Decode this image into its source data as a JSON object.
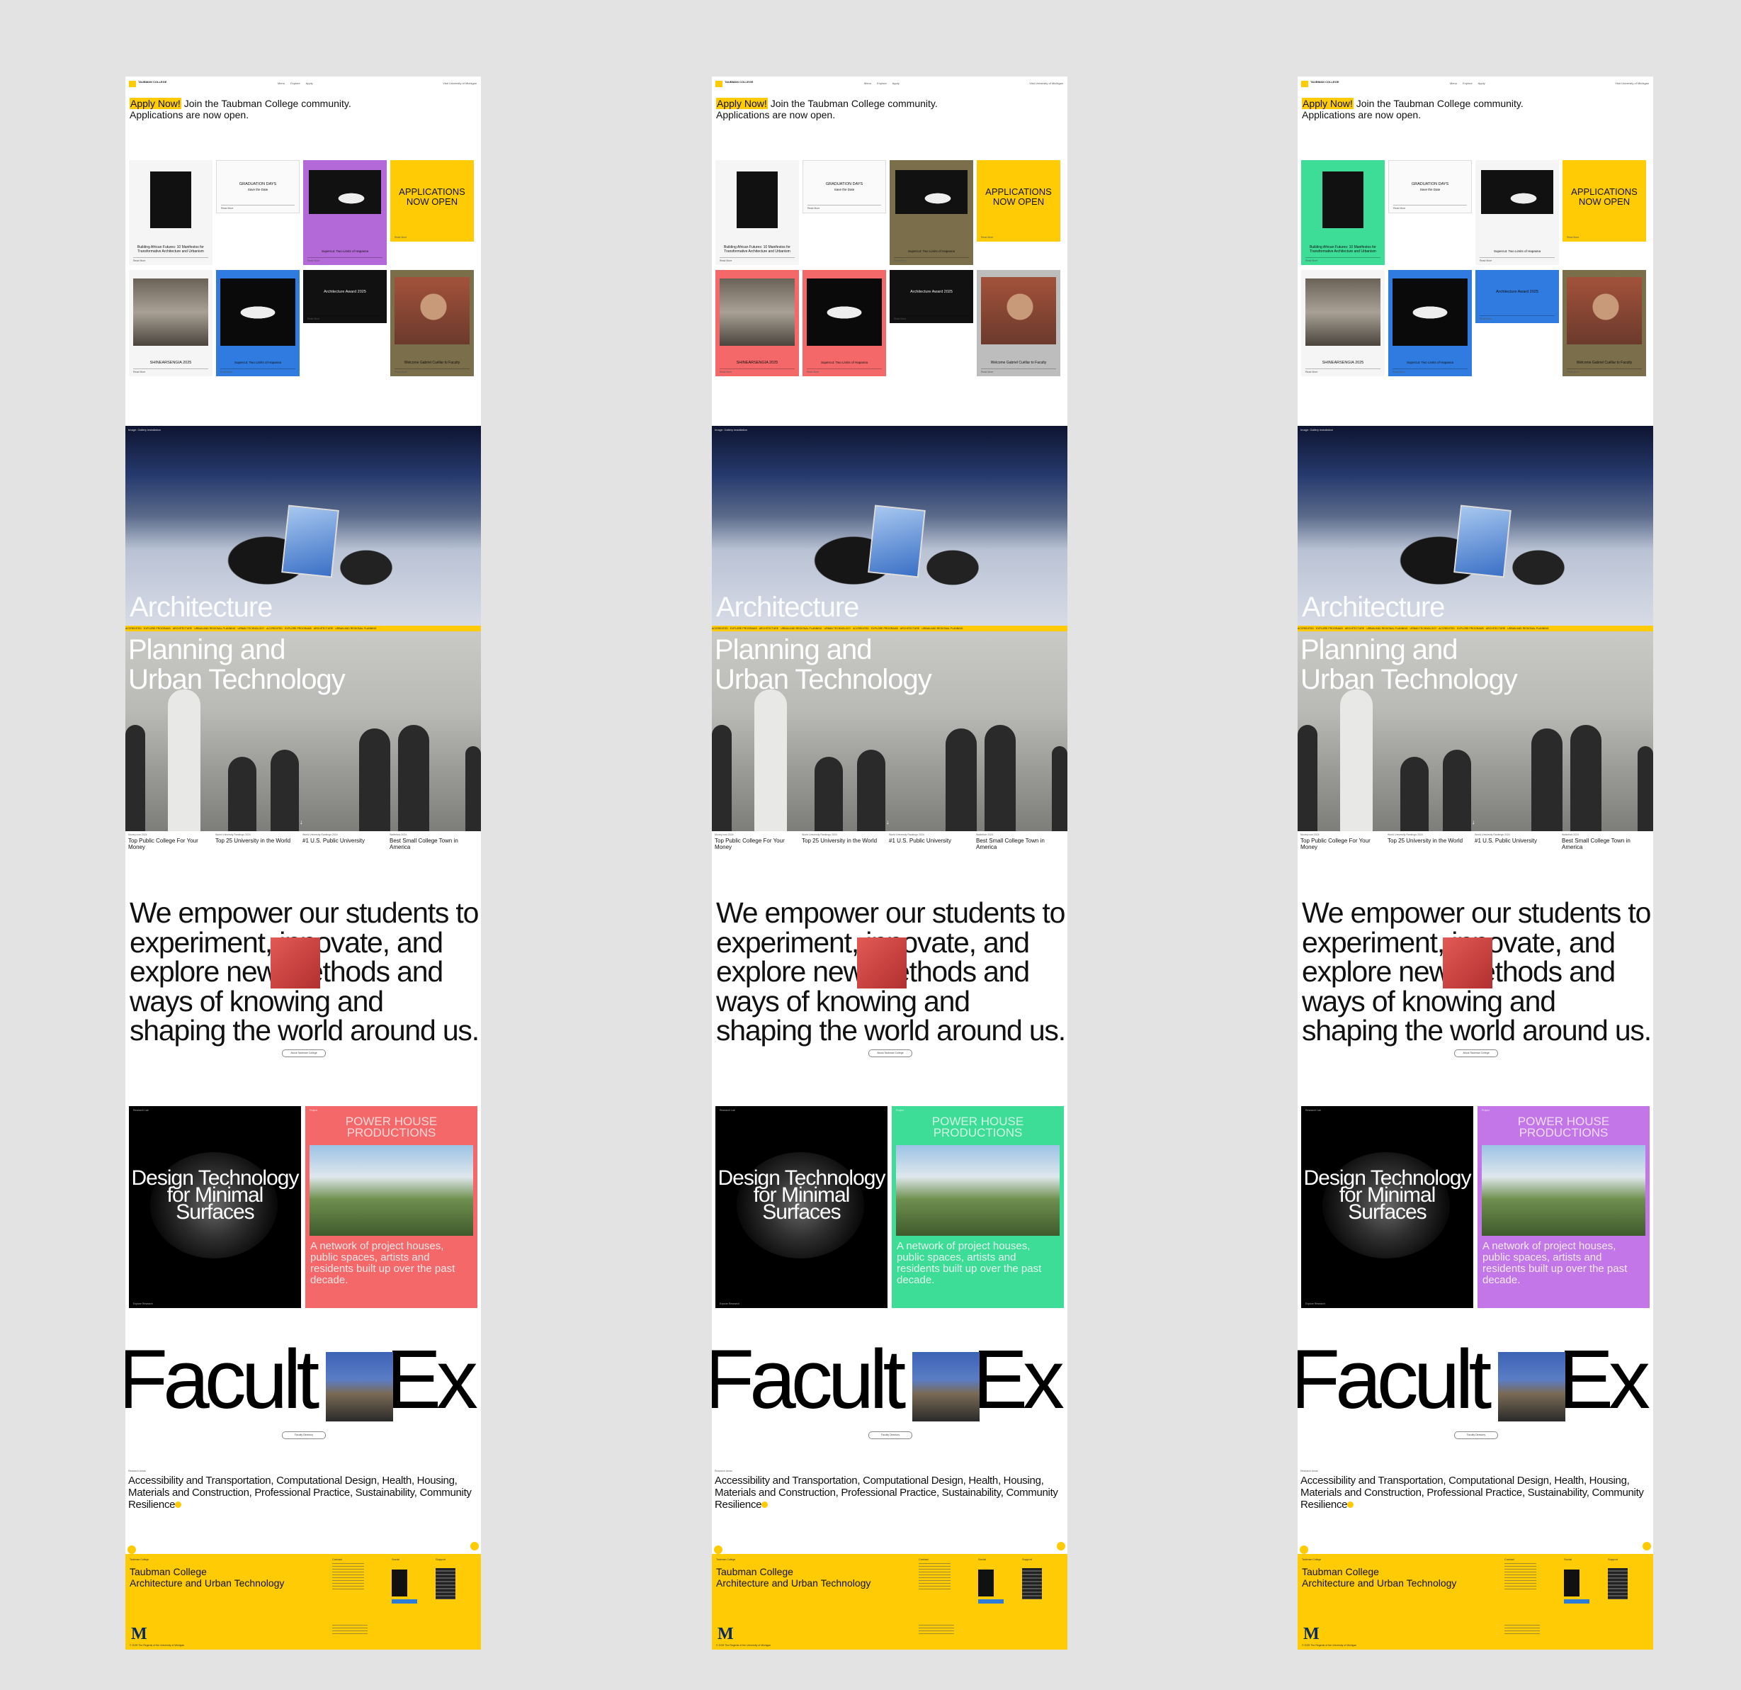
{
  "header": {
    "brand": "TAUBMAN COLLEGE",
    "nav": [
      "Menu",
      "Explore",
      "Apply"
    ],
    "um_link": "Visit University of Michigan"
  },
  "apply_banner": {
    "highlight": "Apply Now!",
    "text_line1": "Join the Taubman College community.",
    "text_line2": "Applications are now open."
  },
  "cards": {
    "building_title": "Building African Futures: 10 Manifestos for Transformative Architecture and Urbanism",
    "graduation_title": "GRADUATION DAYS",
    "graduation_sub": "Save the Date",
    "applications": "APPLICATIONS NOW OPEN",
    "supercut_title": "Supercut: Two Limits of Hapasna",
    "arch_award": "Architecture Award 2025",
    "welcome": "Welcome Gabriel Cuéllar to Faculty",
    "shinearsengia": "SHINEARSENGIA 2025",
    "read_more": "Read More"
  },
  "hero_architecture": {
    "label": "Architecture",
    "caption": "Image: Gallery installation"
  },
  "ticker": {
    "text": "ACCREDITED · EXPLORE PROGRAMS · ARCHITECTURE · URBAN AND REGIONAL PLANNING · URBAN TECHNOLOGY · ACCREDITED · EXPLORE PROGRAMS · ARCHITECTURE · URBAN AND REGIONAL PLANNING"
  },
  "hero_planning": {
    "label_line1": "Planning and",
    "label_line2": "Urban Technology",
    "scroll": "↓"
  },
  "stats": [
    {
      "source": "Money.com 2024",
      "value": "Top Public College For Your Money"
    },
    {
      "source": "World University Rankings 2024",
      "value": "Top 25 University in the World"
    },
    {
      "source": "World University Rankings 2024",
      "value": "#1 U.S. Public University"
    },
    {
      "source": "Wallethub 2024",
      "value": "Best Small College Town in America"
    }
  ],
  "mission": {
    "text": "We empower our students to experiment, innovate, and explore new methods and ways of knowing and shaping the world around us.",
    "button": "About Taubman College"
  },
  "feature_left": {
    "meta": "Research Lab",
    "title": "Design Technology for Minimal Surfaces",
    "foot": "Explore Research"
  },
  "feature_right": {
    "meta": "Project",
    "heading": "POWER HOUSE PRODUCTIONS",
    "desc": "A network of project houses, public spaces, artists and residents built up over the past decade."
  },
  "faculty": {
    "word_left": "Facult",
    "word_right": "Ex",
    "button": "Faculty Directory"
  },
  "areas": {
    "label": "Research Areas",
    "text": "Accessibility and Transportation, Computational Design, Health, Housing, Materials and Construction, Professional Practice, Sustainability, Community Resilience"
  },
  "footer": {
    "small_top": "Taubman College",
    "name_line1": "Taubman College",
    "name_line2": "Architecture and Urban Technology",
    "col1": "Contact",
    "col2": "Social",
    "col3": "Support",
    "m_logo": "M",
    "legal": "© 2025 The Regents of the University of Michigan"
  },
  "variant_colors": {
    "page1": {
      "card_a": "#f5f5f5",
      "card_b": "#b469d9",
      "card_c": "#2f7be0",
      "card_d": "#ffcb05",
      "card_e": "#7a6f4a",
      "feat": "#f4686a"
    },
    "page2": {
      "card_a": "#f5f5f5",
      "card_b": "#7a6f4a",
      "card_c": "#f4686a",
      "card_d": "#ffcb05",
      "card_e": "#bdbdbd",
      "feat": "#3ddc97"
    },
    "page3": {
      "card_a": "#3ddc97",
      "card_b": "#f5f5f5",
      "card_c": "#2f7be0",
      "card_d": "#ffcb05",
      "card_e": "#7a6f4a",
      "feat": "#c276e8"
    }
  }
}
